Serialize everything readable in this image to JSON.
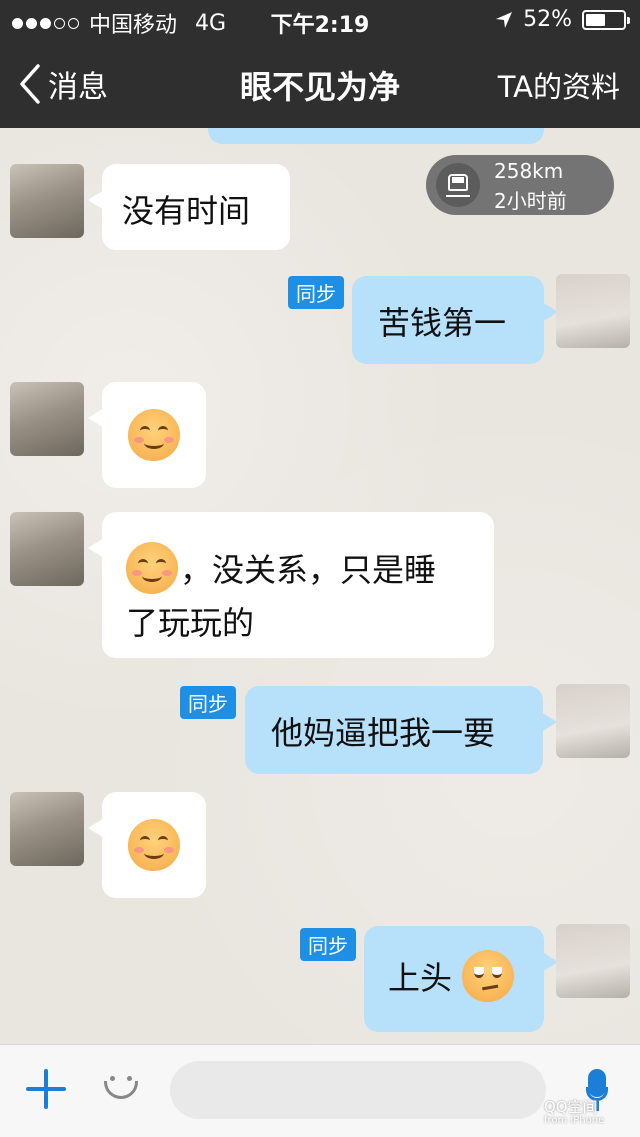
{
  "status_bar": {
    "carrier": "中国移动",
    "network": "4G",
    "time": "下午2:19",
    "battery": "52%",
    "battery_level": 0.52
  },
  "nav": {
    "back_label": "消息",
    "title": "眼不见为净",
    "profile_label": "TA的资料"
  },
  "location_card": {
    "distance": "258km",
    "time_ago": "2小时前",
    "icon": "train-icon"
  },
  "messages": [
    {
      "side": "left",
      "text": "没有时间"
    },
    {
      "side": "right",
      "tag": "同步",
      "text": "苦钱第一"
    },
    {
      "side": "left",
      "emoji": "smile-emoji"
    },
    {
      "side": "left",
      "emoji": "smile-emoji",
      "text_line1": "，没关系，只是睡",
      "text_line2": "了玩玩的"
    },
    {
      "side": "right",
      "tag": "同步",
      "text": "他妈逼把我一要"
    },
    {
      "side": "left",
      "emoji": "smile-emoji"
    },
    {
      "side": "right",
      "tag": "同步",
      "text": "上头",
      "emoji": "smirk-emoji"
    }
  ],
  "input_bar": {
    "placeholder": ""
  },
  "watermark": {
    "line1": "QQ空间",
    "line2": "from iPhone"
  },
  "colors": {
    "nav_bg": "#2f2f2f",
    "left_bubble": "#ffffff",
    "right_bubble": "#b7e0fb",
    "accent": "#1c7ed6",
    "sync_tag": "#1f8fe5"
  }
}
